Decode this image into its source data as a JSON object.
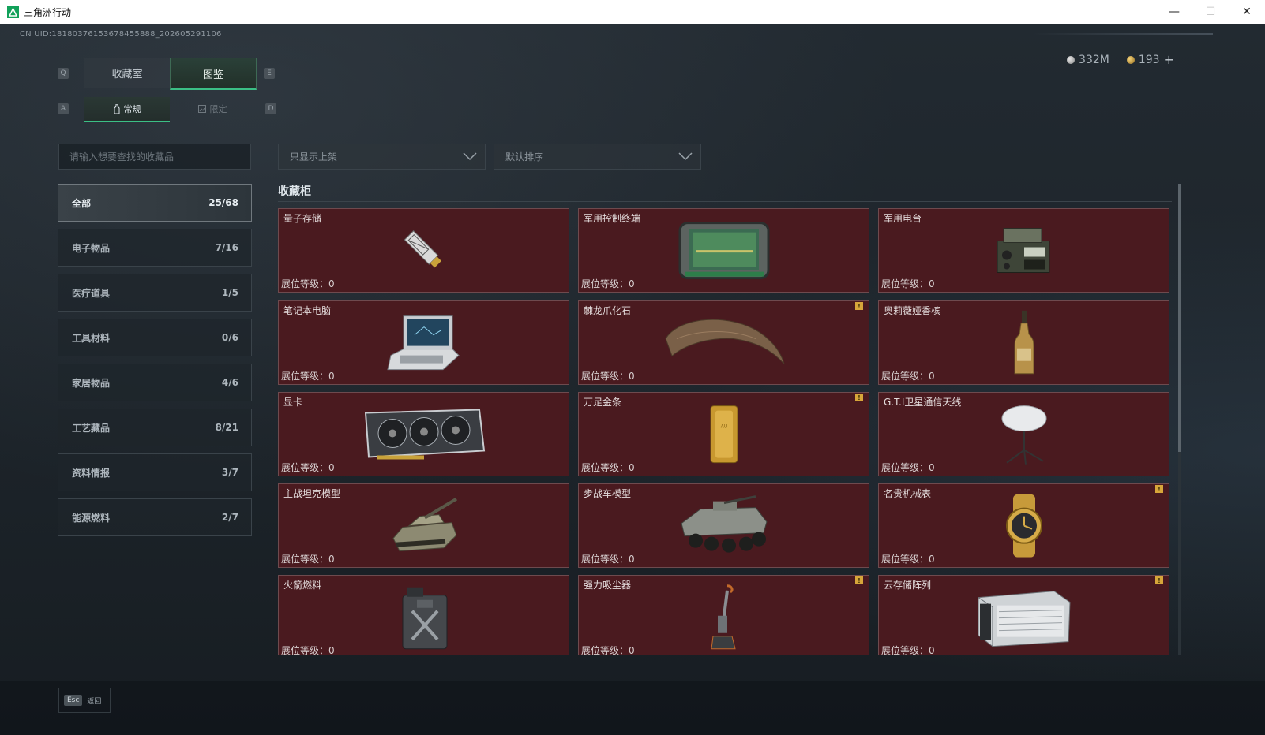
{
  "window": {
    "title": "三角洲行动",
    "minimize": "—",
    "maximize": "☐",
    "close": "✕"
  },
  "uid": "CN UID:18180376153678455888_202605291106",
  "currency": {
    "silver": "332M",
    "gold": "193",
    "plus": "+"
  },
  "keys": {
    "q": "Q",
    "e": "E",
    "a": "A",
    "d": "D"
  },
  "tabs": {
    "collection_room": "收藏室",
    "catalog": "图鉴"
  },
  "subtabs": {
    "regular": "常规",
    "limited": "限定"
  },
  "search": {
    "placeholder": "请输入想要查找的收藏品"
  },
  "filters": {
    "shelf": "只显示上架",
    "sort": "默认排序"
  },
  "categories": [
    {
      "name": "全部",
      "count": "25/68",
      "active": true
    },
    {
      "name": "电子物品",
      "count": "7/16"
    },
    {
      "name": "医疗道具",
      "count": "1/5"
    },
    {
      "name": "工具材料",
      "count": "0/6"
    },
    {
      "name": "家居物品",
      "count": "4/6"
    },
    {
      "name": "工艺藏品",
      "count": "8/21"
    },
    {
      "name": "资料情报",
      "count": "3/7"
    },
    {
      "name": "能源燃料",
      "count": "2/7"
    }
  ],
  "section_title": "收藏柜",
  "level_label": "展位等级：0",
  "warn_mark": "!",
  "items": [
    {
      "name": "量子存储",
      "icon": "ssd-icon"
    },
    {
      "name": "军用控制终端",
      "icon": "tablet-terminal-icon"
    },
    {
      "name": "军用电台",
      "icon": "radio-icon"
    },
    {
      "name": "笔记本电脑",
      "icon": "laptop-icon"
    },
    {
      "name": "棘龙爪化石",
      "icon": "claw-fossil-icon",
      "warn": true
    },
    {
      "name": "奥莉薇娅香槟",
      "icon": "champagne-icon"
    },
    {
      "name": "显卡",
      "icon": "gpu-icon"
    },
    {
      "name": "万足金条",
      "icon": "gold-bar-icon",
      "warn": true
    },
    {
      "name": "G.T.I卫星通信天线",
      "icon": "satellite-dish-icon"
    },
    {
      "name": "主战坦克模型",
      "icon": "tank-icon"
    },
    {
      "name": "步战车模型",
      "icon": "ifv-icon"
    },
    {
      "name": "名贵机械表",
      "icon": "watch-icon",
      "warn": true
    },
    {
      "name": "火箭燃料",
      "icon": "fuel-can-icon"
    },
    {
      "name": "强力吸尘器",
      "icon": "vacuum-icon",
      "warn": true
    },
    {
      "name": "云存储阵列",
      "icon": "storage-array-icon",
      "warn": true
    }
  ],
  "esc": {
    "key": "Esc",
    "label": "返回"
  }
}
